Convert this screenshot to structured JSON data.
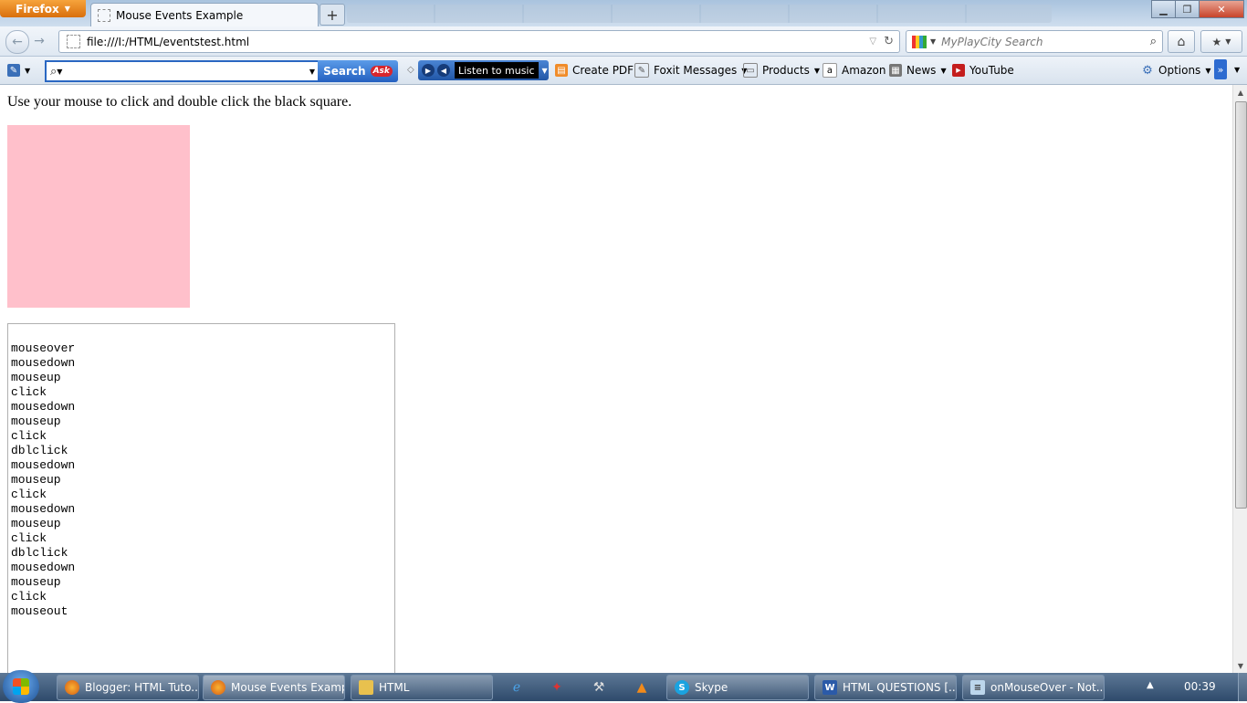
{
  "browser": {
    "menu_button": "Firefox",
    "tab_title": "Mouse Events Example",
    "new_tab": "+",
    "url": "file:///I:/HTML/eventstest.html",
    "search_placeholder": "MyPlayCity Search"
  },
  "toolbar": {
    "search_button": "Search",
    "ask_logo": "Ask",
    "music": "Listen to music",
    "bookmarks": [
      {
        "label": "Create PDF",
        "icon": "pdf-icon"
      },
      {
        "label": "Foxit Messages",
        "icon": "foxit-icon",
        "dropdown": true
      },
      {
        "label": "Products",
        "icon": "products-icon",
        "dropdown": true
      },
      {
        "label": "Amazon",
        "icon": "amazon-icon"
      },
      {
        "label": "News",
        "icon": "news-icon",
        "dropdown": true
      },
      {
        "label": "YouTube",
        "icon": "youtube-icon"
      }
    ],
    "options": "Options",
    "overflow": "»"
  },
  "page": {
    "instructions": "Use your mouse to click and double click the black square.",
    "square_color": "#ffc0cb",
    "log": [
      "mouseover",
      "mousedown",
      "mouseup",
      "click",
      "mousedown",
      "mouseup",
      "click",
      "dblclick",
      "mousedown",
      "mouseup",
      "click",
      "mousedown",
      "mouseup",
      "click",
      "dblclick",
      "mousedown",
      "mouseup",
      "click",
      "mouseout"
    ]
  },
  "taskbar": {
    "buttons": [
      {
        "label": "Blogger: HTML Tuto...",
        "icon": "firefox-icon"
      },
      {
        "label": "Mouse Events Examp...",
        "icon": "firefox-icon",
        "active": true
      },
      {
        "label": "HTML",
        "icon": "folder-icon"
      },
      {
        "label": "Skype",
        "icon": "skype-icon"
      },
      {
        "label": "HTML QUESTIONS [...",
        "icon": "word-icon"
      },
      {
        "label": "onMouseOver - Not...",
        "icon": "notepad-icon"
      }
    ],
    "clock": "00:39"
  }
}
